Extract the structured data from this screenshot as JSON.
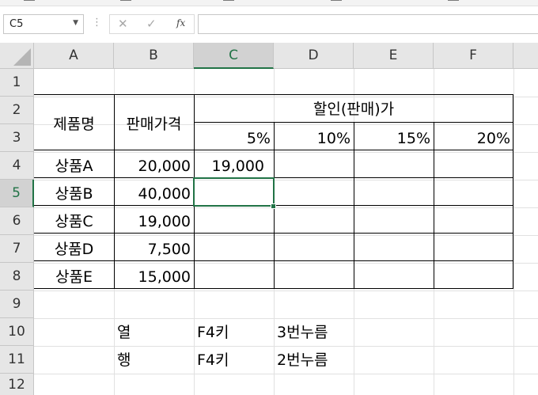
{
  "name_box": "C5",
  "formula_buttons": {
    "cancel": "✕",
    "enter": "✓",
    "fx": "fx"
  },
  "formula_value": "",
  "columns": [
    "A",
    "B",
    "C",
    "D",
    "E",
    "F"
  ],
  "selected_column": "C",
  "rows": [
    "1",
    "2",
    "3",
    "4",
    "5",
    "6",
    "7",
    "8",
    "9",
    "10",
    "11",
    "12"
  ],
  "selected_row": "5",
  "cells": {
    "A2": "제품명",
    "B2": "판매가격",
    "C2": "할인(판매)가",
    "C3": "5%",
    "D3": "10%",
    "E3": "15%",
    "F3": "20%",
    "A4": "상품A",
    "B4": "20,000",
    "C4": "19,000",
    "A5": "상품B",
    "B5": "40,000",
    "A6": "상품C",
    "B6": "19,000",
    "A7": "상품D",
    "B7": "7,500",
    "A8": "상품E",
    "B8": "15,000",
    "B10": "열",
    "C10": "F4키",
    "D10": "3번누름",
    "B11": "행",
    "C11": "F4키",
    "D11": "2번누름"
  },
  "colors": {
    "accent": "#217346",
    "header_bg": "#e6e6e6",
    "header_selected_bg": "#d2d2d2",
    "gridline": "#e1e1e1"
  }
}
